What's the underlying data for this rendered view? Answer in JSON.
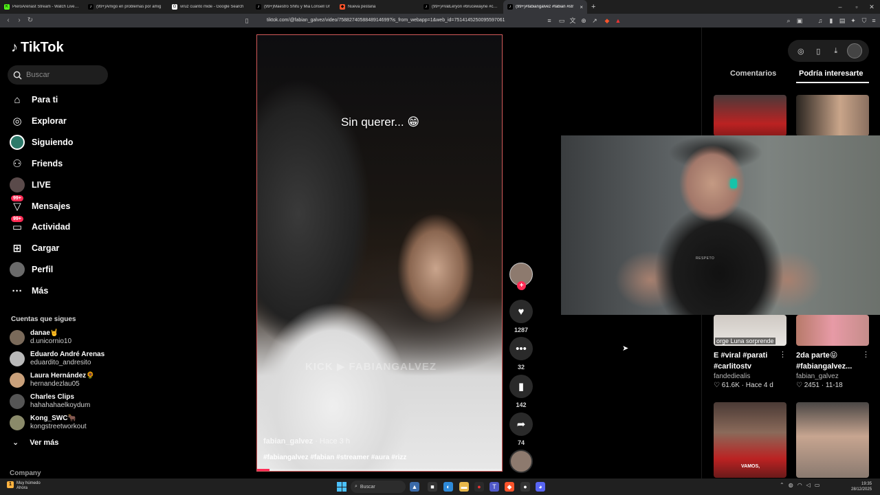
{
  "browser": {
    "tabs": [
      {
        "title": "PieroArenast Stream - Watch Live on",
        "icon": "K",
        "icon_color": "#53fc18"
      },
      {
        "title": "(99+)Amigo en problemas por amig",
        "icon": "♪",
        "icon_color": "#000000"
      },
      {
        "title": "viruz cuanto mide - Google Search",
        "icon": "G",
        "icon_color": "#ffffff"
      },
      {
        "title": "(99+)Maestro Shifu y Mia Lonsell Ur",
        "icon": "♪",
        "icon_color": "#000000"
      },
      {
        "title": "Nueva pestaña",
        "icon": "◆",
        "icon_color": "#fb542b"
      },
      {
        "title": "(99+)#ValLeryon #brucewayne #chris",
        "icon": "♪",
        "icon_color": "#000000"
      },
      {
        "title": "(99+)#fabiangalvez #fabian #str",
        "icon": "♪",
        "icon_color": "#000000",
        "active": true
      }
    ],
    "url": "tiktok.com/@fabian_galvez/video/7588274058848914699?is_from_webapp=1&web_id=7514145250095597061"
  },
  "sidebar": {
    "logo": "TikTok",
    "search_placeholder": "Buscar",
    "nav": [
      {
        "label": "Para ti",
        "icon": "home-icon"
      },
      {
        "label": "Explorar",
        "icon": "compass-icon"
      },
      {
        "label": "Siguiendo",
        "icon": "following-avatar"
      },
      {
        "label": "Friends",
        "icon": "friends-icon"
      },
      {
        "label": "LIVE",
        "icon": "live-avatar"
      },
      {
        "label": "Mensajes",
        "icon": "messages-icon",
        "badge": "99+"
      },
      {
        "label": "Actividad",
        "icon": "activity-icon",
        "badge": "99+"
      },
      {
        "label": "Cargar",
        "icon": "upload-icon"
      },
      {
        "label": "Perfil",
        "icon": "profile-avatar"
      },
      {
        "label": "Más",
        "icon": "more-icon"
      }
    ],
    "following_title": "Cuentas que sigues",
    "following": [
      {
        "name": "danae🤘",
        "handle": "d.unicornio10",
        "color": "#7a6a5a"
      },
      {
        "name": "Eduardo André Arenas",
        "handle": "eduardito_andresito",
        "color": "#b9b9b9"
      },
      {
        "name": "Laura Hernández🌻",
        "handle": "hernandezlau05",
        "color": "#c9a07a"
      },
      {
        "name": "Charles Clips",
        "handle": "hahahahaelkoydum",
        "color": "#555555"
      },
      {
        "name": "Kong_SWC🐂",
        "handle": "kongstreetworkout",
        "color": "#8a8a6a"
      }
    ],
    "see_more": "Ver más",
    "company": "Company"
  },
  "video": {
    "caption": "Sin querer... 😁",
    "watermark": "KICK ▶ FABIANGALVEZ",
    "author": "fabian_galvez",
    "time": "· Hace 3 h",
    "tags": "#fabiangalvez #fabian #streamer #aura #rizz",
    "progress": 0.05
  },
  "actions": {
    "likes": "1287",
    "comments": "32",
    "saves": "142",
    "shares": "74"
  },
  "right_panel": {
    "tab_comments": "Comentarios",
    "tab_interest": "Podría interesarte",
    "cards": [
      {
        "title": "E #viral #parati #carlitostv",
        "author": "fandediealis",
        "likes": "61.6K",
        "date": "Hace 4 d",
        "overlay": "orge Luna sorprende"
      },
      {
        "title": "2da parte😝 #fabiangalvez...",
        "author": "fabian_galvez",
        "likes": "2451",
        "date": "11-18"
      }
    ],
    "bottom_overlay": "VAMOS,"
  },
  "webcam": {
    "shirt_text": "RESPETO"
  },
  "taskbar": {
    "weather_title": "Muy húmedo",
    "weather_sub": "Ahora",
    "search": "Buscar",
    "time": "19:35",
    "date": "28/12/2025"
  }
}
